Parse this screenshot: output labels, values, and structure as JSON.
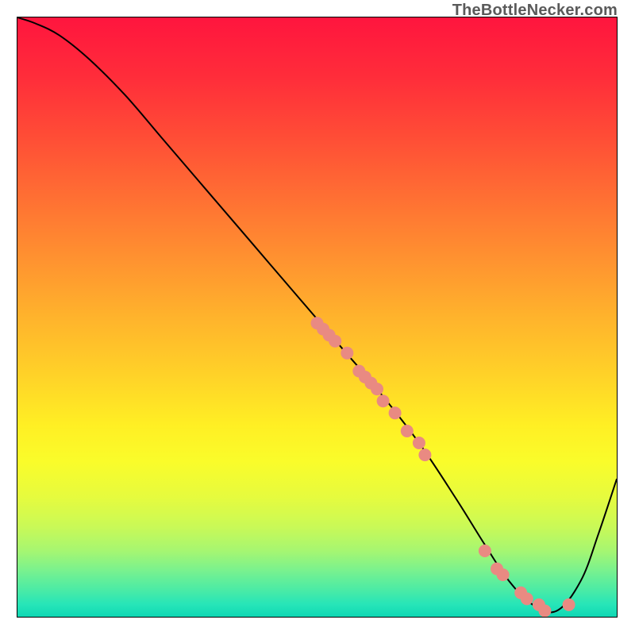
{
  "watermark": "TheBottleNecker.com",
  "gradient": {
    "stops": [
      {
        "offset": 0.0,
        "color": "#ff153e"
      },
      {
        "offset": 0.1,
        "color": "#ff2d3a"
      },
      {
        "offset": 0.2,
        "color": "#ff4d36"
      },
      {
        "offset": 0.3,
        "color": "#ff6f33"
      },
      {
        "offset": 0.4,
        "color": "#ff9130"
      },
      {
        "offset": 0.5,
        "color": "#ffb32c"
      },
      {
        "offset": 0.6,
        "color": "#ffd328"
      },
      {
        "offset": 0.68,
        "color": "#ffef24"
      },
      {
        "offset": 0.74,
        "color": "#fafc2a"
      },
      {
        "offset": 0.8,
        "color": "#e6fb3e"
      },
      {
        "offset": 0.85,
        "color": "#c9f957"
      },
      {
        "offset": 0.89,
        "color": "#a6f671"
      },
      {
        "offset": 0.92,
        "color": "#7df28c"
      },
      {
        "offset": 0.95,
        "color": "#52eca2"
      },
      {
        "offset": 0.98,
        "color": "#26e5b8"
      },
      {
        "offset": 1.0,
        "color": "#0fd7b4"
      }
    ]
  },
  "chart_data": {
    "type": "line",
    "title": "",
    "xlabel": "",
    "ylabel": "",
    "xlim": [
      0,
      100
    ],
    "ylim": [
      0,
      100
    ],
    "series": [
      {
        "name": "bottleneck-curve",
        "x": [
          0,
          3,
          7,
          12,
          18,
          24,
          30,
          36,
          42,
          48,
          54,
          60,
          67,
          73,
          78,
          82,
          86,
          90,
          94,
          97,
          100
        ],
        "y": [
          100,
          99,
          97,
          93,
          87,
          80,
          73,
          66,
          59,
          52,
          45,
          38,
          29,
          20,
          12,
          6,
          2,
          1,
          6,
          14,
          23
        ]
      }
    ],
    "points": {
      "name": "highlighted-points",
      "color": "#e98a82",
      "radius_px": 8,
      "x": [
        50,
        51,
        52,
        53,
        55,
        57,
        58,
        59,
        60,
        61,
        63,
        65,
        67,
        68,
        78,
        80,
        81,
        84,
        85,
        87,
        88,
        92
      ],
      "y": [
        49,
        48,
        47,
        46,
        44,
        41,
        40,
        39,
        38,
        36,
        34,
        31,
        29,
        27,
        11,
        8,
        7,
        4,
        3,
        2,
        1,
        2
      ]
    }
  }
}
